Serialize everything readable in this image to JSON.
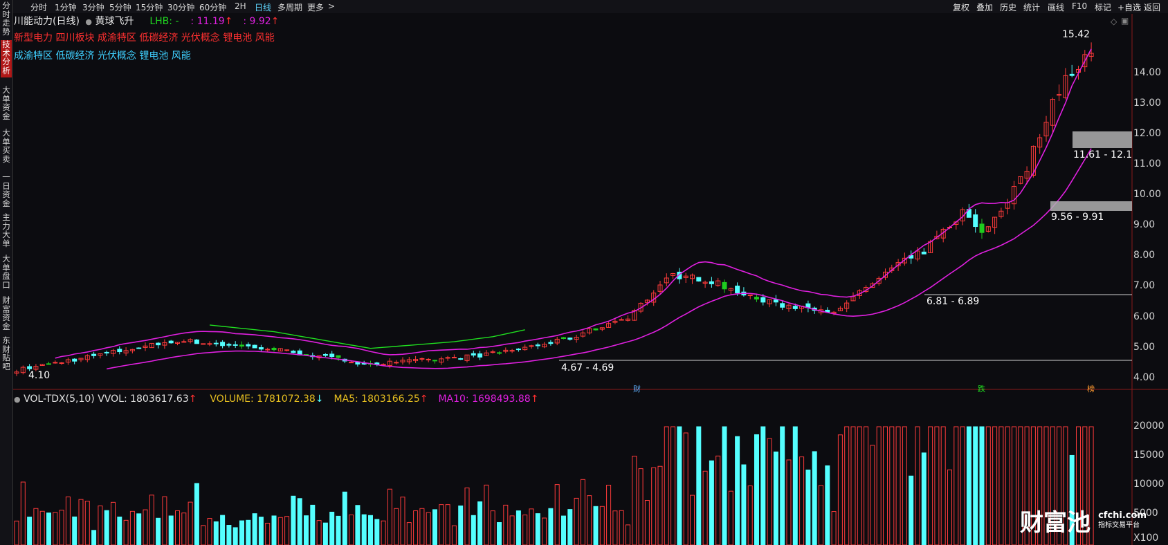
{
  "sidebar": {
    "tabs": [
      {
        "label": "分时走势",
        "active": false
      },
      {
        "label": "技术分析",
        "active": true
      },
      {
        "label": "大单资金",
        "active": false
      },
      {
        "label": "大单买卖",
        "active": false
      },
      {
        "label": "一日资金",
        "active": false
      },
      {
        "label": "主力大单",
        "active": false
      },
      {
        "label": "大单盘口",
        "active": false
      },
      {
        "label": "财富资金",
        "active": false
      },
      {
        "label": "东财贴吧",
        "active": false
      }
    ]
  },
  "toolbar": {
    "periods": [
      {
        "label": "分时",
        "active": false
      },
      {
        "label": "1分钟",
        "active": false
      },
      {
        "label": "3分钟",
        "active": false
      },
      {
        "label": "5分钟",
        "active": false
      },
      {
        "label": "15分钟",
        "active": false
      },
      {
        "label": "30分钟",
        "active": false
      },
      {
        "label": "60分钟",
        "active": false
      },
      {
        "label": "2H",
        "active": false
      },
      {
        "label": "日线",
        "active": true
      },
      {
        "label": "多周期",
        "active": false
      },
      {
        "label": "更多",
        "active": false
      }
    ],
    "right": [
      "复权",
      "叠加",
      "历史",
      "统计",
      "画线",
      "F10",
      "标记",
      "+自选",
      "返回"
    ]
  },
  "stock": {
    "name_line": "川能动力(日线)",
    "indicator": "黄球飞升",
    "lhb_label": "LHB: -",
    "val1": ": 11.19",
    "val2": ": 9.92",
    "arrow": "↑",
    "arrow_down": "↓",
    "concepts_red": "新型电力 四川板块 成渝特区 低碳经济 光伏概念 锂电池 风能",
    "concepts_cyan": "成渝特区 低碳经济 光伏概念 锂电池 风能"
  },
  "price_axis": {
    "ticks": [
      "14.00",
      "13.00",
      "12.00",
      "11.00",
      "10.00",
      "9.00",
      "8.00",
      "7.00",
      "6.00",
      "5.00",
      "4.00"
    ],
    "min": 3.9,
    "max": 15.6
  },
  "levels": {
    "high_label": "15.42",
    "low_label": "4.10",
    "zones": [
      "11.61 - 12.1",
      "9.56 - 9.91",
      "6.81 - 6.89",
      "4.67 - 4.69"
    ]
  },
  "markers": [
    "财",
    "跌",
    "榜"
  ],
  "volume": {
    "title": "VOL-TDX(5,10)",
    "vvol": "VVOL: 1803617.63",
    "volume": "VOLUME: 1781072.38",
    "ma5": "MA5: 1803166.25",
    "ma10": "MA10: 1698493.88",
    "ticks": [
      "20000",
      "15000",
      "10000",
      "5000"
    ],
    "unit": "X100"
  },
  "watermark": {
    "brand": "财富池",
    "site": "cfchi.com",
    "slogan": "指标交易平台"
  },
  "colors": {
    "up": "#ff3b3b",
    "down_cyan": "#54ffff",
    "down_green": "#1fcc1f",
    "magenta": "#e020e0",
    "yellow": "#e8c020",
    "green_line": "#20e020"
  }
}
